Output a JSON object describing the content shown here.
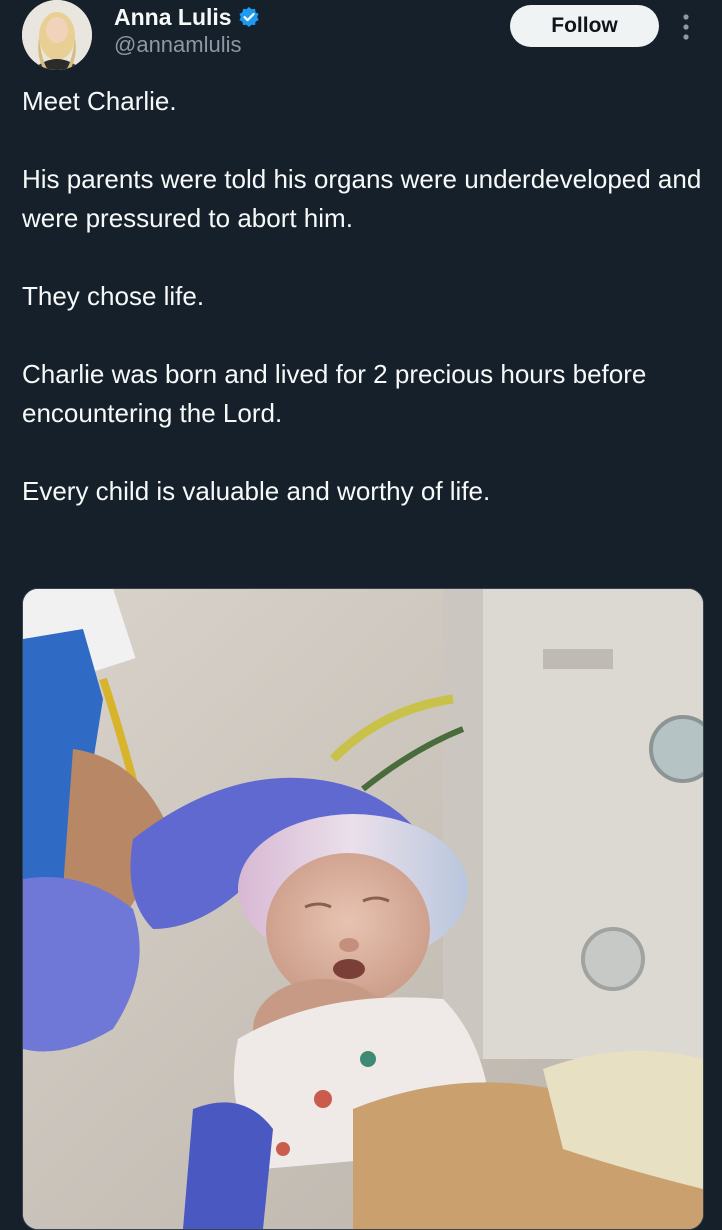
{
  "author": {
    "display_name": "Anna Lulis",
    "handle": "@annamlulis",
    "verified": true,
    "avatar_icon": "profile-photo"
  },
  "actions": {
    "follow_label": "Follow",
    "more_icon": "more-vertical-icon"
  },
  "tweet": {
    "paragraphs": [
      "Meet Charlie.",
      "His parents were told his organs were underdeveloped and were pressured to abort him.",
      "They chose life.",
      "Charlie was born and lived for 2 precious hours before encountering the Lord.",
      "Every child is valuable and worthy of life."
    ]
  },
  "media": {
    "kind": "photo"
  },
  "colors": {
    "background": "#15202b",
    "text": "#f7f9f9",
    "secondary_text": "#8b98a5",
    "verified_blue": "#1d9bf0",
    "follow_button_bg": "#eff3f4"
  }
}
